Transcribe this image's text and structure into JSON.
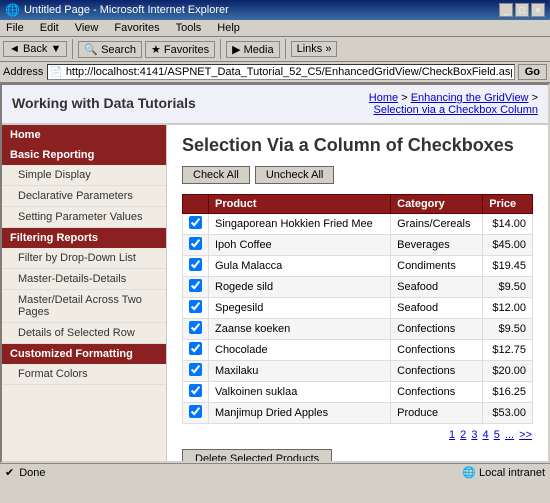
{
  "window": {
    "title": "Untitled Page - Microsoft Internet Explorer",
    "icon": "🌐"
  },
  "menu": {
    "items": [
      "File",
      "Edit",
      "View",
      "Favorites",
      "Tools",
      "Help"
    ]
  },
  "toolbar": {
    "back": "← Back",
    "search": "Search",
    "favorites": "Favorites"
  },
  "address": {
    "label": "Address",
    "url": "http://localhost:4141/ASPNET_Data_Tutorial_52_C5/EnhancedGridView/CheckBoxField.aspx",
    "go": "Go"
  },
  "header": {
    "site_title": "Working with Data Tutorials",
    "breadcrumb": [
      {
        "text": "Home",
        "href": "#"
      },
      {
        "text": "Enhancing the GridView",
        "href": "#"
      },
      {
        "text": "Selection via a Checkbox Column",
        "href": "#"
      }
    ]
  },
  "nav": {
    "home": "Home",
    "sections": [
      {
        "label": "Basic Reporting",
        "items": [
          "Simple Display",
          "Declarative Parameters",
          "Setting Parameter Values"
        ]
      },
      {
        "label": "Filtering Reports",
        "items": [
          "Filter by Drop-Down List",
          "Master-Details-Details",
          "Master/Detail Across Two Pages",
          "Details of Selected Row"
        ]
      },
      {
        "label": "Customized Formatting",
        "items": [
          "Format Colors"
        ]
      }
    ]
  },
  "page": {
    "heading": "Selection Via a Column of Checkboxes",
    "check_all": "Check All",
    "uncheck_all": "Uncheck All"
  },
  "table": {
    "columns": [
      "",
      "Product",
      "Category",
      "Price"
    ],
    "rows": [
      {
        "checked": true,
        "product": "Singaporean Hokkien Fried Mee",
        "category": "Grains/Cereals",
        "price": "$14.00"
      },
      {
        "checked": true,
        "product": "Ipoh Coffee",
        "category": "Beverages",
        "price": "$45.00"
      },
      {
        "checked": true,
        "product": "Gula Malacca",
        "category": "Condiments",
        "price": "$19.45"
      },
      {
        "checked": true,
        "product": "Rogede sild",
        "category": "Seafood",
        "price": "$9.50"
      },
      {
        "checked": true,
        "product": "Spegesild",
        "category": "Seafood",
        "price": "$12.00"
      },
      {
        "checked": true,
        "product": "Zaanse koeken",
        "category": "Confections",
        "price": "$9.50"
      },
      {
        "checked": true,
        "product": "Chocolade",
        "category": "Confections",
        "price": "$12.75"
      },
      {
        "checked": true,
        "product": "Maxilaku",
        "category": "Confections",
        "price": "$20.00"
      },
      {
        "checked": true,
        "product": "Valkoinen suklaa",
        "category": "Confections",
        "price": "$16.25"
      },
      {
        "checked": true,
        "product": "Manjimup Dried Apples",
        "category": "Produce",
        "price": "$53.00"
      }
    ],
    "pagination": [
      "1",
      "2",
      "3",
      "4",
      "5",
      "...",
      ">>"
    ],
    "delete_btn": "Delete Selected Products"
  },
  "status": {
    "left": "Done",
    "right": "Local intranet"
  }
}
